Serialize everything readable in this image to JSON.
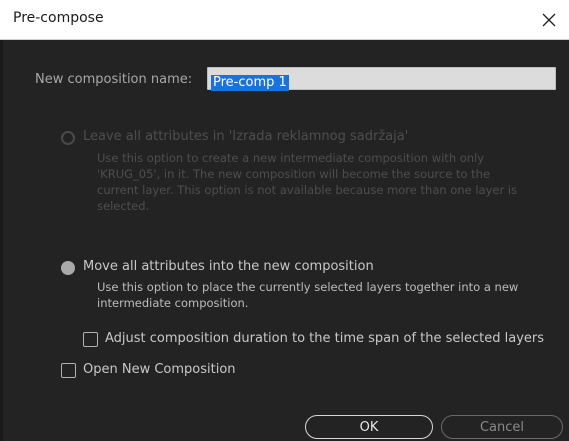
{
  "window": {
    "title": "Pre-compose"
  },
  "name_field": {
    "label": "New composition name:",
    "value": "Pre-comp 1"
  },
  "option_leave": {
    "title": "Leave all attributes in 'Izrada reklamnog sadržaja'",
    "desc": [
      "Use this option to create a new intermediate composition with only",
      "'KRUG_05', in it. The new composition will become the source to the",
      "current layer. This option is not available because more than one layer is",
      "selected."
    ],
    "state": "disabled"
  },
  "option_move": {
    "title": "Move all attributes into the new composition",
    "desc": [
      "Use this option to place the currently selected layers together into a new",
      "intermediate composition."
    ],
    "state": "selected"
  },
  "adjust_duration": {
    "label": "Adjust composition duration to the time span of the selected layers",
    "checked": false
  },
  "open_new": {
    "label": "Open New Composition",
    "checked": false
  },
  "buttons": {
    "ok": "OK",
    "cancel": "Cancel"
  },
  "colors": {
    "dialog_bg": "#232323",
    "titlebar_bg": "#ffffff",
    "selection": "#1a73d9"
  }
}
